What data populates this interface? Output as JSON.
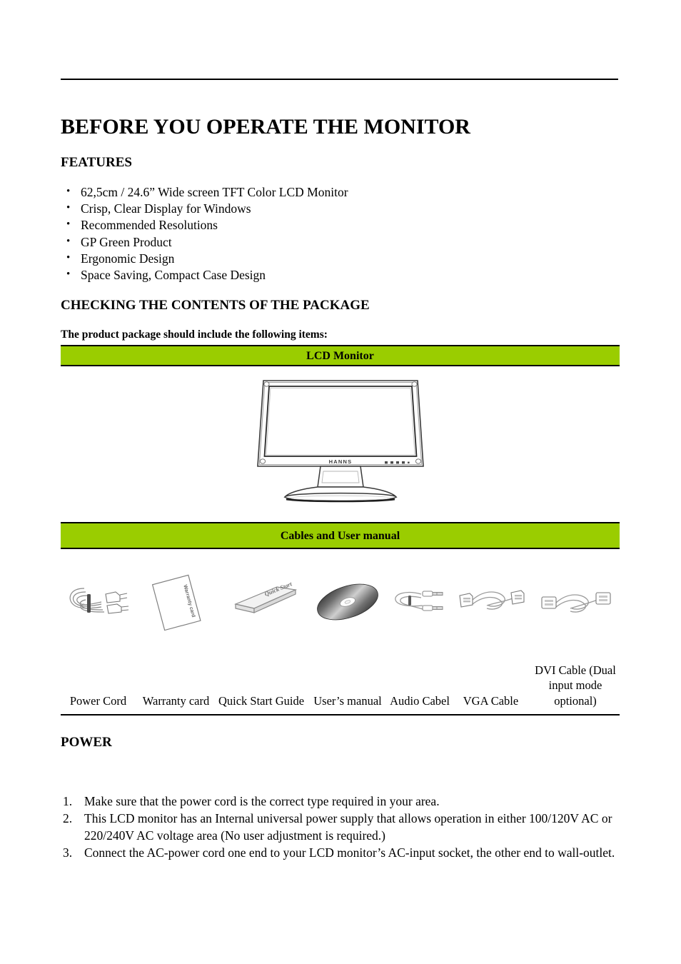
{
  "document": {
    "title": "BEFORE YOU OPERATE THE MONITOR"
  },
  "sections": {
    "features": {
      "heading": "FEATURES",
      "items": [
        "62,5cm / 24.6” Wide screen TFT Color LCD Monitor",
        "Crisp, Clear Display for Windows",
        "Recommended Resolutions",
        "GP Green Product",
        "Ergonomic Design",
        "Space Saving, Compact Case Design"
      ]
    },
    "package": {
      "heading": "CHECKING THE CONTENTS OF THE PACKAGE",
      "intro": "The product package should include the following items:",
      "banner_monitor": "LCD Monitor",
      "banner_cables": "Cables and User manual",
      "monitor_logo": "HANNS",
      "accessories": [
        {
          "caption": "Power Cord",
          "icon": "power-cord-icon"
        },
        {
          "caption": "Warranty card",
          "icon": "warranty-card-icon",
          "art_text": "Warranty card"
        },
        {
          "caption": "Quick Start Guide",
          "icon": "quick-start-guide-icon",
          "art_text": "Quick Start"
        },
        {
          "caption": "User’s manual",
          "icon": "cd-disc-icon"
        },
        {
          "caption": "Audio Cabel",
          "icon": "audio-cable-icon"
        },
        {
          "caption": "VGA Cable",
          "icon": "vga-cable-icon"
        },
        {
          "caption": "DVI Cable (Dual input mode optional)",
          "icon": "dvi-cable-icon"
        }
      ]
    },
    "power": {
      "heading": "POWER",
      "items": [
        "Make sure that the power cord is the correct type required in your area.",
        "This LCD monitor has an Internal universal power supply that allows operation in either 100/120V AC or 220/240V AC voltage area (No user adjustment is required.)",
        "Connect the AC-power cord one end to your LCD monitor’s AC-input socket, the other end to wall-outlet."
      ]
    }
  },
  "colors": {
    "banner_green": "#9ACD00",
    "rule_black": "#000000"
  }
}
